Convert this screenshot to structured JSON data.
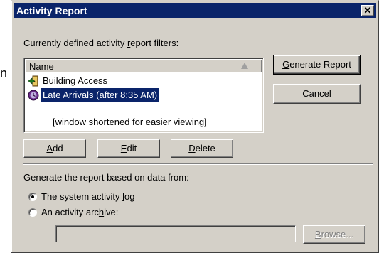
{
  "background": {
    "fragment_text": "n"
  },
  "window": {
    "title": "Activity Report",
    "close_symbol": "✕"
  },
  "filters": {
    "label_before": "Currently defined activity ",
    "label_hotkey": "r",
    "label_after": "eport filters:",
    "column_header": "Name",
    "rows": [
      {
        "label": "Building Access",
        "icon": "door-icon",
        "selected": false
      },
      {
        "label": "Late Arrivals (after 8:35 AM)",
        "icon": "clock-badge-icon",
        "selected": true
      },
      {
        "label": "[window shortened for easier viewing]",
        "icon": "",
        "selected": false
      }
    ]
  },
  "buttons": {
    "generate": {
      "hotkey": "G",
      "rest": "enerate Report"
    },
    "cancel": {
      "label": "Cancel"
    },
    "add": {
      "hotkey": "A",
      "rest": "dd"
    },
    "edit": {
      "hotkey": "E",
      "rest": "dit"
    },
    "delete": {
      "hotkey": "D",
      "rest": "elete"
    },
    "browse": {
      "hotkey": "B",
      "rest": "rowse..."
    }
  },
  "source": {
    "label": "Generate the report based on data from:",
    "options": [
      {
        "before": "The system activity ",
        "hotkey": "l",
        "after": "og",
        "selected": true
      },
      {
        "before": "An activity arc",
        "hotkey": "h",
        "after": "ive:",
        "selected": false
      }
    ],
    "archive_path": ""
  },
  "colors": {
    "titlebar": "#0a246a",
    "dialog_face": "#d4d0c8",
    "selection": "#0a246a"
  }
}
